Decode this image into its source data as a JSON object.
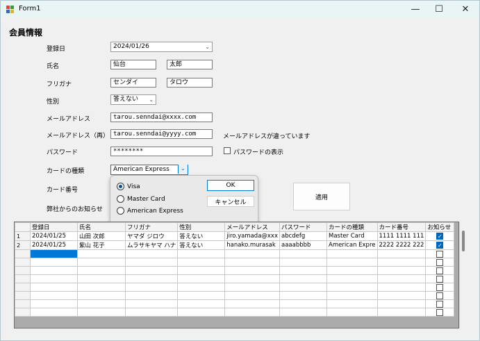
{
  "window": {
    "title": "Form1",
    "minimize_glyph": "—",
    "maximize_glyph": "☐",
    "close_glyph": "✕"
  },
  "form": {
    "heading": "会員情報",
    "register_date_label": "登録日",
    "register_date_value": "2024/01/26",
    "name_label": "氏名",
    "last_name": "仙台",
    "first_name": "太郎",
    "furigana_label": "フリガナ",
    "last_kana": "センダイ",
    "first_kana": "タロウ",
    "gender_label": "性別",
    "gender_value": "答えない",
    "email_label": "メールアドレス",
    "email_value": "tarou.senndai@xxxx.com",
    "email_confirm_label": "メールアドレス（再）",
    "email_confirm_value": "tarou.senndai@yyyy.com",
    "email_mismatch_msg": "メールアドレスが違っています",
    "password_label": "パスワード",
    "password_value": "********",
    "show_password_label": "パスワードの表示",
    "card_type_label": "カードの種類",
    "card_type_value": "American Express",
    "card_number_label": "カード番号",
    "notice_label": "弊社からのお知らせ",
    "apply_button": "適用"
  },
  "popup": {
    "options": [
      "Visa",
      "Master Card",
      "American Express"
    ],
    "selected": "Visa",
    "ok_button": "OK",
    "cancel_button": "キャンセル"
  },
  "grid": {
    "columns": [
      "登録日",
      "氏名",
      "フリガナ",
      "性別",
      "メールアドレス",
      "パスワード",
      "カードの種類",
      "カード番号",
      "お知らせ"
    ],
    "rows": [
      {
        "num": "1",
        "cells": [
          "2024/01/25",
          "山田 次郎",
          "ヤマダ ジロウ",
          "答えない",
          "jiro.yamada@xxx",
          "abcdefg",
          "Master Card",
          "1111 1111 111"
        ],
        "notice": true
      },
      {
        "num": "2",
        "cells": [
          "2024/01/25",
          "紫山 花子",
          "ムラサキヤマ ハナ",
          "答えない",
          "hanako.murasak",
          "aaaabbbb",
          "American Expre",
          "2222 2222 222"
        ],
        "notice": true
      }
    ],
    "empty_row_count": 8
  },
  "colors": {
    "accent": "#0067c0",
    "selection": "#0078d7"
  }
}
